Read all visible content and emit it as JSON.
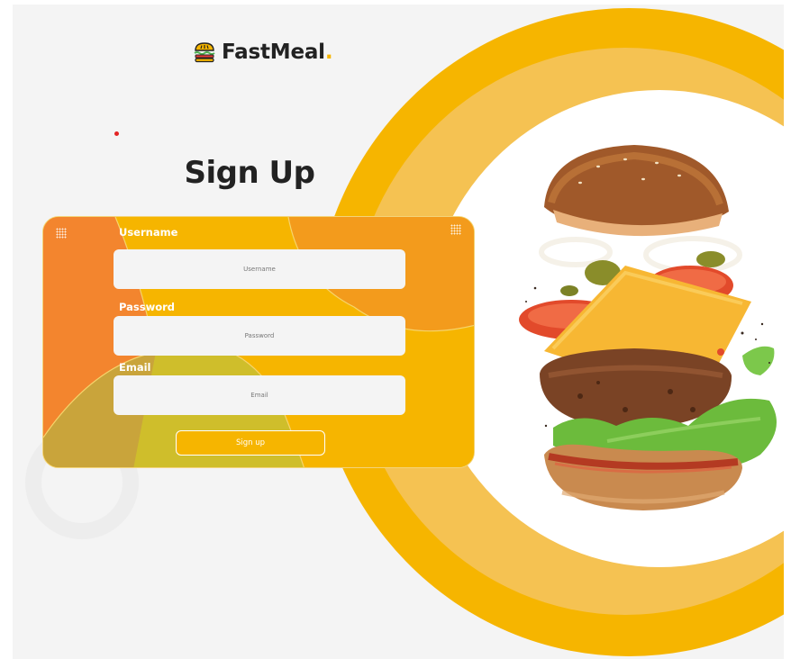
{
  "brand": {
    "name": "FastMeal",
    "dot": ".",
    "accent_color": "#f6b500",
    "logo_icon": "burger-icon"
  },
  "page": {
    "title": "Sign Up"
  },
  "form": {
    "username": {
      "label": "Username",
      "placeholder": "Username"
    },
    "password": {
      "label": "Password",
      "placeholder": "Password"
    },
    "email": {
      "label": "Email",
      "placeholder": "Email"
    },
    "submit_label": "Sign up"
  },
  "colors": {
    "primary": "#f6b500",
    "orange": "#f3852e",
    "olive": "#c9a43b",
    "background": "#f4f4f4"
  }
}
